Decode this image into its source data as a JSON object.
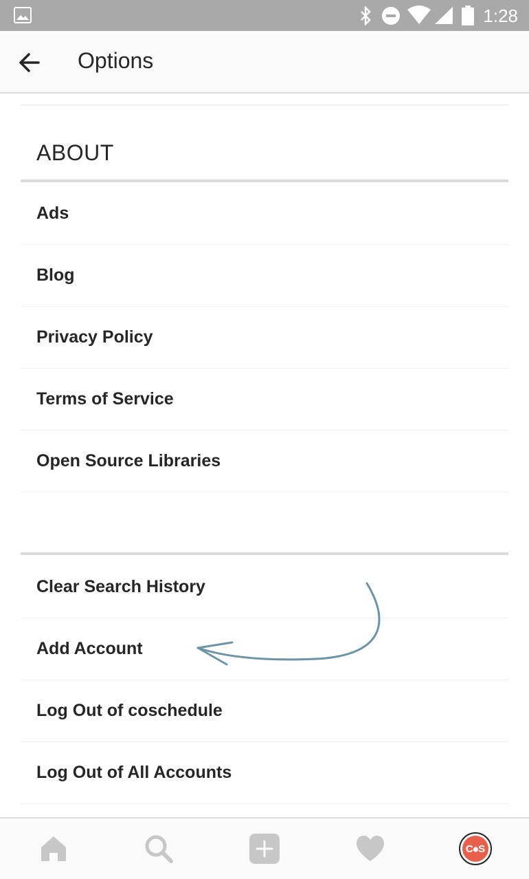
{
  "status_bar": {
    "time": "1:28",
    "icons": [
      "image-icon",
      "bluetooth-icon",
      "do-not-disturb-icon",
      "wifi-icon",
      "signal-icon",
      "battery-icon"
    ]
  },
  "header": {
    "title": "Options",
    "back_icon": "arrow-left-icon"
  },
  "about_section": {
    "title": "ABOUT",
    "items": [
      {
        "label": "Ads"
      },
      {
        "label": "Blog"
      },
      {
        "label": "Privacy Policy"
      },
      {
        "label": "Terms of Service"
      },
      {
        "label": "Open Source Libraries"
      }
    ]
  },
  "account_section": {
    "items": [
      {
        "label": "Clear Search History"
      },
      {
        "label": "Add Account"
      },
      {
        "label": "Log Out of coschedule"
      },
      {
        "label": "Log Out of All Accounts"
      }
    ]
  },
  "bottom_nav": {
    "items": [
      "home-icon",
      "search-icon",
      "add-post-icon",
      "activity-heart-icon",
      "profile-avatar-icon"
    ],
    "avatar_text": "C⦁S"
  },
  "colors": {
    "status_bar": "#a9a9a9",
    "annotation_arrow": "#6c93a6",
    "avatar_accent": "#e8604c",
    "nav_icon": "#c7c7c7"
  }
}
